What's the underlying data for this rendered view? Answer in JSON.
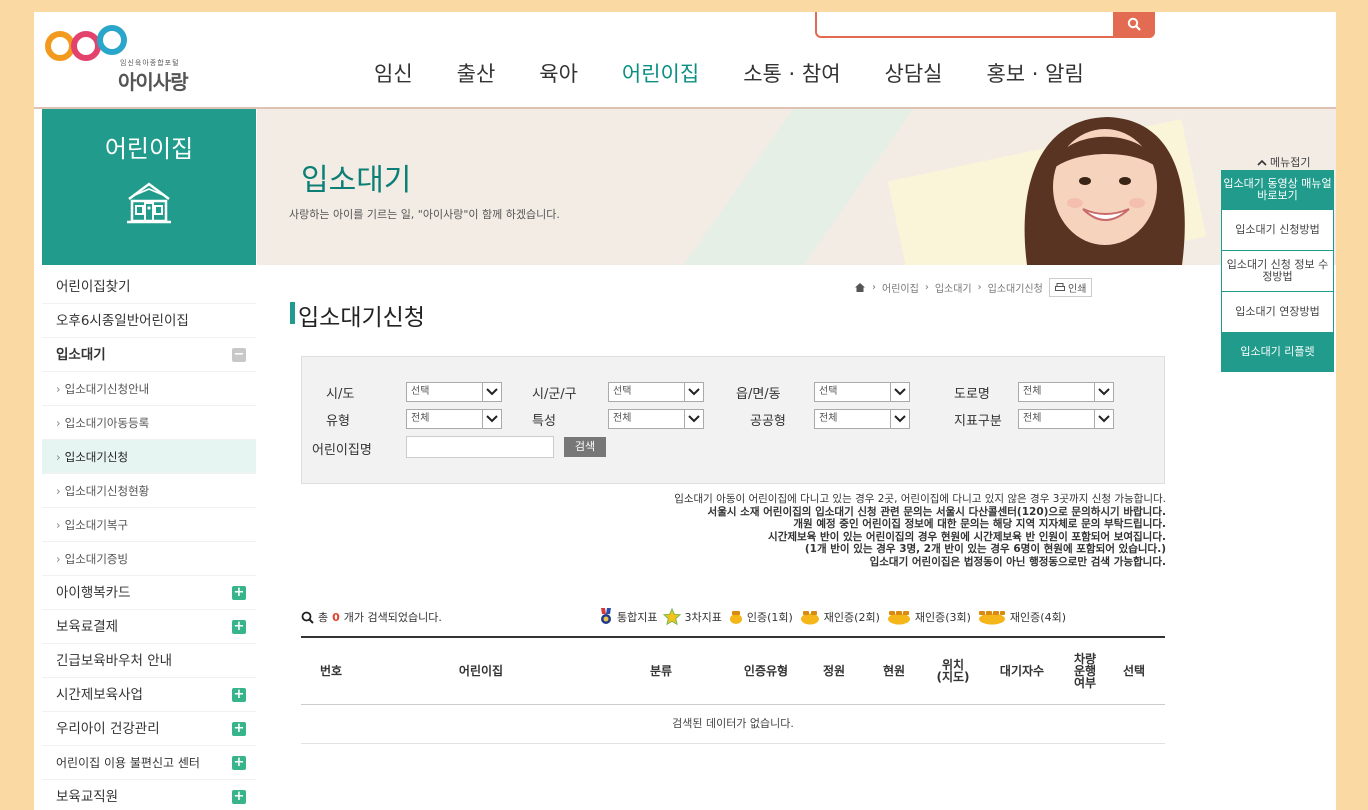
{
  "header": {
    "logo_tagline": "임신육아종합포털",
    "logo_brand": "아이사랑",
    "nav": [
      {
        "label": "임신"
      },
      {
        "label": "출산"
      },
      {
        "label": "육아"
      },
      {
        "label": "어린이집",
        "active": true
      },
      {
        "label": "소통 · 참여"
      },
      {
        "label": "상담실"
      },
      {
        "label": "홍보 · 알림"
      }
    ],
    "search_value": ""
  },
  "sidebar": {
    "title": "어린이집",
    "items": [
      {
        "label": "어린이집찾기"
      },
      {
        "label": "오후6시종일반어린이집"
      },
      {
        "label": "입소대기",
        "toggle": "minus"
      },
      {
        "label": "입소대기신청안내",
        "sub": true
      },
      {
        "label": "입소대기아동등록",
        "sub": true
      },
      {
        "label": "입소대기신청",
        "sub": true,
        "selected": true
      },
      {
        "label": "입소대기신청현황",
        "sub": true
      },
      {
        "label": "입소대기복구",
        "sub": true
      },
      {
        "label": "입소대기증빙",
        "sub": true
      },
      {
        "label": "아이행복카드",
        "toggle": "plus"
      },
      {
        "label": "보육료결제",
        "toggle": "plus"
      },
      {
        "label": "긴급보육바우처 안내"
      },
      {
        "label": "시간제보육사업",
        "toggle": "plus"
      },
      {
        "label": "우리아이 건강관리",
        "toggle": "plus"
      },
      {
        "label": "어린이집 이용 불편신고 센터",
        "toggle": "plus"
      },
      {
        "label": "보육교직원",
        "toggle": "plus"
      }
    ]
  },
  "banner": {
    "title": "입소대기",
    "subtitle": "사랑하는 아이를 기르는 일, \"아이사랑\"이 함께 하겠습니다."
  },
  "breadcrumb": [
    "어린이집",
    "입소대기",
    "입소대기신청"
  ],
  "print_label": "인쇄",
  "page_title": "입소대기신청",
  "filter": {
    "sido": {
      "label": "시/도",
      "value": "선택"
    },
    "sigungu": {
      "label": "시/군/구",
      "value": "선택"
    },
    "eup": {
      "label": "읍/면/동",
      "value": "선택"
    },
    "road": {
      "label": "도로명",
      "value": "전체"
    },
    "type": {
      "label": "유형",
      "value": "전체"
    },
    "feature": {
      "label": "특성",
      "value": "전체"
    },
    "public": {
      "label": "공공형",
      "value": "전체"
    },
    "indicator": {
      "label": "지표구분",
      "value": "전체"
    },
    "name": {
      "label": "어린이집명",
      "value": ""
    },
    "search_button": "검색"
  },
  "notices": [
    {
      "text": "입소대기 아동이 어린이집에 다니고 있는 경우 2곳, 어린이집에 다니고 있지 않은 경우 3곳까지 신청 가능합니다.",
      "bold": false
    },
    {
      "text": "서울시 소재 어린이집의 입소대기 신청 관련 문의는 서울시 다산콜센터(120)으로 문의하시기 바랍니다.",
      "bold": true
    },
    {
      "text": "개원 예정 중인 어린이집 정보에 대한 문의는 해당 지역 지자체로 문의 부탁드립니다.",
      "bold": true
    },
    {
      "text": "시간제보육 반이 있는 어린이집의 경우 현원에 시간제보육 반 인원이 포함되어 보여집니다.",
      "bold": true
    },
    {
      "text": "(1개 반이 있는 경우 3명, 2개 반이 있는 경우 6명이 현원에 포함되어 있습니다.)",
      "bold": true
    },
    {
      "text": "입소대기 어린이집은 법정동이 아닌 행정동으로만 검색 가능합니다.",
      "bold": true
    }
  ],
  "result": {
    "prefix": "총",
    "count": "0",
    "suffix": "개가 검색되었습니다."
  },
  "legend": [
    {
      "label": "통합지표",
      "icon": "medal-ribbon-icon"
    },
    {
      "label": "3차지표",
      "icon": "star-badge-icon"
    },
    {
      "label": "인증(1회)",
      "icon": "honey-pot-1-icon"
    },
    {
      "label": "재인증(2회)",
      "icon": "honey-pot-2-icon"
    },
    {
      "label": "재인증(3회)",
      "icon": "honey-pot-3-icon"
    },
    {
      "label": "재인증(4회)",
      "icon": "honey-pot-4-icon"
    }
  ],
  "table": {
    "headers": [
      "번호",
      "어린이집",
      "분류",
      "인증유형",
      "정원",
      "현원",
      "위치\n(지도)",
      "대기자수",
      "차량\n운행\n여부",
      "선택"
    ],
    "empty_message": "검색된 데이터가 없습니다."
  },
  "quick_menu": {
    "toggle": "메뉴접기",
    "items": [
      {
        "label": "입소대기 동영상 매뉴얼 바로보기",
        "green": true
      },
      {
        "label": "입소대기 신청방법"
      },
      {
        "label": "입소대기 신청 정보 수정방법"
      },
      {
        "label": "입소대기 연장방법"
      },
      {
        "label": "입소대기 리플렛",
        "green": true
      }
    ]
  },
  "colors": {
    "accent": "#219c8c",
    "search": "#e26b52",
    "background": "#fbd9a3"
  }
}
